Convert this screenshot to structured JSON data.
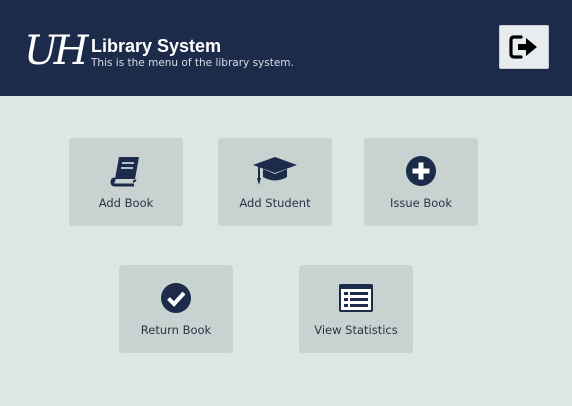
{
  "header": {
    "logo_text": "UH",
    "title": "Library System",
    "subtitle": "This is the menu of the library system.",
    "logout_icon": "sign-out-icon"
  },
  "menu": {
    "tiles": [
      {
        "label": "Add Book",
        "icon": "book-icon"
      },
      {
        "label": "Add Student",
        "icon": "graduation-cap-icon"
      },
      {
        "label": "Issue Book",
        "icon": "plus-circle-icon"
      },
      {
        "label": "Return Book",
        "icon": "check-circle-icon"
      },
      {
        "label": "View Statistics",
        "icon": "list-alt-icon"
      }
    ]
  },
  "colors": {
    "header_bg": "#1c2b4a",
    "page_bg": "#dce6e5",
    "tile_bg": "#c8d2d1",
    "icon": "#1c2b4a"
  }
}
